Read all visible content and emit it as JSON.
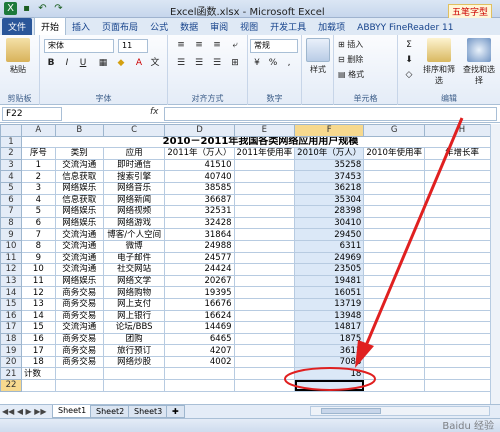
{
  "window": {
    "title": "Excel函数.xlsx - Microsoft Excel",
    "watermark": "五笔字型"
  },
  "tabs": [
    {
      "label": "文件"
    },
    {
      "label": "开始"
    },
    {
      "label": "插入"
    },
    {
      "label": "页面布局"
    },
    {
      "label": "公式"
    },
    {
      "label": "数据"
    },
    {
      "label": "审阅"
    },
    {
      "label": "视图"
    },
    {
      "label": "开发工具"
    },
    {
      "label": "加载项"
    },
    {
      "label": "ABBYY FineReader 11"
    }
  ],
  "ribbon": {
    "paste": "粘贴",
    "clipboard": "剪贴板",
    "font_name": "宋体",
    "font_size": "11",
    "font_group": "字体",
    "bold": "B",
    "italic": "I",
    "underline": "U",
    "align_group": "对齐方式",
    "number_format": "常规",
    "number_group": "数字",
    "style": "样式",
    "insert": "插入",
    "delete": "删除",
    "format": "格式",
    "cells_group": "单元格",
    "sort": "排序和筛选",
    "find": "查找和选择",
    "edit_group": "编辑",
    "wen": "文"
  },
  "formula_bar": {
    "name_box": "F22",
    "fx": "fx",
    "value": ""
  },
  "columns": [
    "A",
    "B",
    "C",
    "D",
    "E",
    "F",
    "G",
    "H"
  ],
  "title_row": "2010－2011年我国各类网络应用用户规模",
  "header": [
    "序号",
    "类别",
    "应用",
    "2011年（万人）",
    "2011年使用率",
    "2010年（万人）",
    "2010年使用率",
    "年增长率"
  ],
  "rows": [
    [
      "1",
      "交流沟通",
      "即时通信",
      "41510",
      "",
      "35258",
      "",
      ""
    ],
    [
      "2",
      "信息获取",
      "搜索引擎",
      "40740",
      "",
      "37453",
      "",
      ""
    ],
    [
      "3",
      "网络娱乐",
      "网络音乐",
      "38585",
      "",
      "36218",
      "",
      ""
    ],
    [
      "4",
      "信息获取",
      "网络新闻",
      "36687",
      "",
      "35304",
      "",
      ""
    ],
    [
      "5",
      "网络娱乐",
      "网络视频",
      "32531",
      "",
      "28398",
      "",
      ""
    ],
    [
      "6",
      "网络娱乐",
      "网络游戏",
      "32428",
      "",
      "30410",
      "",
      ""
    ],
    [
      "7",
      "交流沟通",
      "博客/个人空间",
      "31864",
      "",
      "29450",
      "",
      ""
    ],
    [
      "8",
      "交流沟通",
      "微博",
      "24988",
      "",
      "6311",
      "",
      ""
    ],
    [
      "9",
      "交流沟通",
      "电子邮件",
      "24577",
      "",
      "24969",
      "",
      ""
    ],
    [
      "10",
      "交流沟通",
      "社交网站",
      "24424",
      "",
      "23505",
      "",
      ""
    ],
    [
      "11",
      "网络娱乐",
      "网络文学",
      "20267",
      "",
      "19481",
      "",
      ""
    ],
    [
      "12",
      "商务交易",
      "网络购物",
      "19395",
      "",
      "16051",
      "",
      ""
    ],
    [
      "13",
      "商务交易",
      "网上支付",
      "16676",
      "",
      "13719",
      "",
      ""
    ],
    [
      "14",
      "商务交易",
      "网上银行",
      "16624",
      "",
      "13948",
      "",
      ""
    ],
    [
      "15",
      "交流沟通",
      "论坛/BBS",
      "14469",
      "",
      "14817",
      "",
      ""
    ],
    [
      "16",
      "商务交易",
      "团购",
      "6465",
      "",
      "1875",
      "",
      ""
    ],
    [
      "17",
      "商务交易",
      "旅行预订",
      "4207",
      "",
      "3613",
      "",
      ""
    ],
    [
      "18",
      "商务交易",
      "网络炒股",
      "4002",
      "",
      "7088",
      "",
      ""
    ]
  ],
  "count_label": "计数",
  "count_value": "18",
  "row_numbers": [
    "1",
    "2",
    "3",
    "4",
    "5",
    "6",
    "7",
    "8",
    "9",
    "10",
    "11",
    "12",
    "13",
    "14",
    "15",
    "16",
    "17",
    "18",
    "19",
    "20",
    "21",
    "22"
  ],
  "sheets": [
    "Sheet1",
    "Sheet2",
    "Sheet3"
  ],
  "watermark_bottom": "Baidu 经验",
  "colors": {
    "accent": "#2a5699",
    "annotation": "#e02020",
    "highlight": "#f7d98e"
  }
}
